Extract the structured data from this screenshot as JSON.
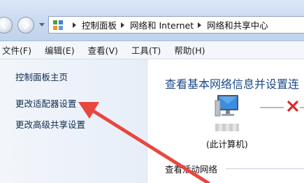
{
  "address_bar": {
    "crumbs": [
      "控制面板",
      "网络和 Internet",
      "网络和共享中心"
    ],
    "icons": [
      "back-arrow-icon",
      "forward-arrow-icon",
      "history-dropdown-icon",
      "control-panel-icon",
      "breadcrumb-separator-icon"
    ]
  },
  "menu": {
    "items": [
      "文件(F)",
      "编辑(E)",
      "查看(V)",
      "工具(T)",
      "帮助(H)"
    ]
  },
  "nav": {
    "links": [
      "控制面板主页",
      "更改适配器设置",
      "更改高级共享设置"
    ]
  },
  "main": {
    "title": "查看基本网络信息并设置连",
    "computer_label": "(此计算机)",
    "section_label": "查看活动网络",
    "icons": [
      "computer-icon",
      "disconnected-x-icon"
    ]
  },
  "annotation": {
    "arrow_color": "#e8473e"
  },
  "colors": {
    "title_blue": "#1a4a8c",
    "link_dark": "#0e2a4f",
    "error_red": "#d62c2c"
  }
}
